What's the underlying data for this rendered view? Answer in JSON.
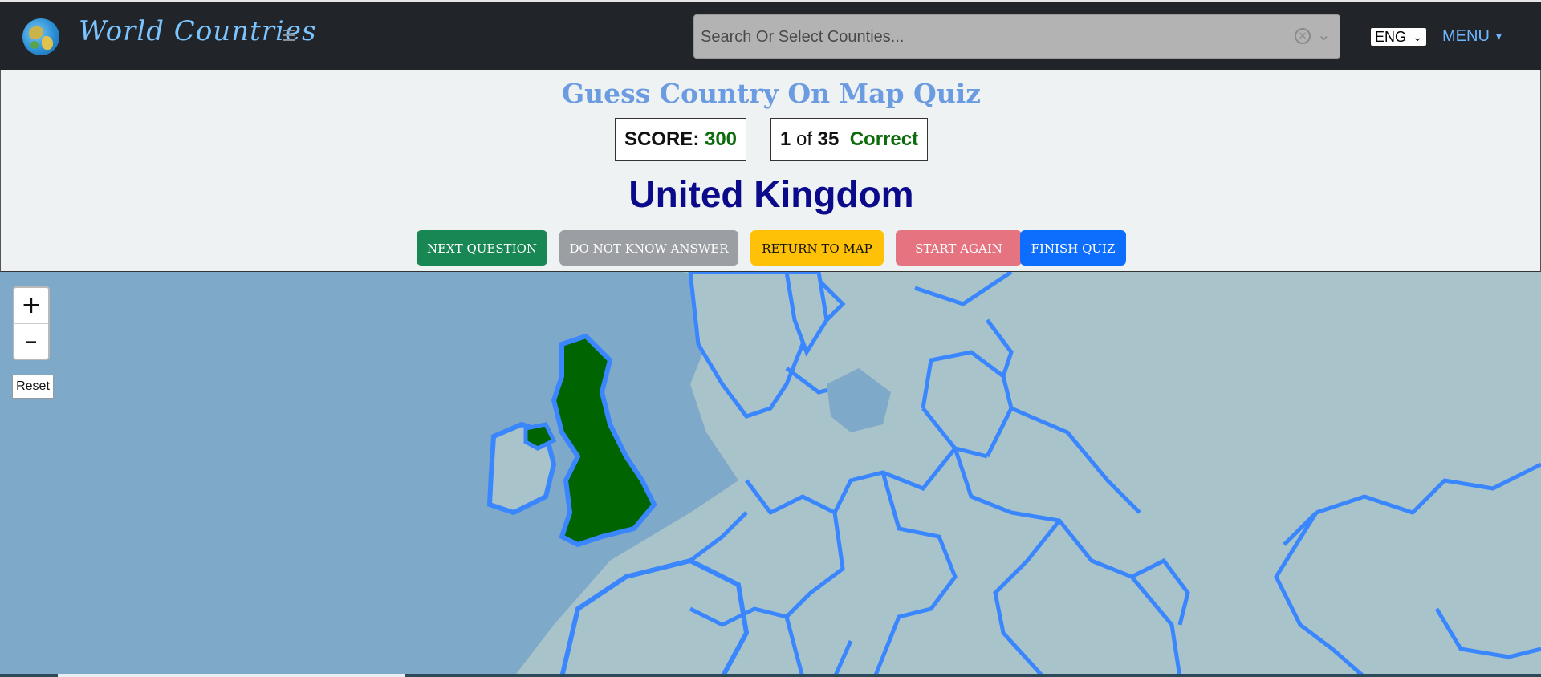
{
  "header": {
    "brand": "World Countries",
    "search_placeholder": "Search Or Select Counties...",
    "language": "ENG",
    "menu_label": "MENU"
  },
  "quiz": {
    "title": "Guess Country On Map Quiz",
    "score_label": "SCORE:",
    "score_value": "300",
    "progress_current": "1",
    "progress_of": "of",
    "progress_total": "35",
    "progress_status": "Correct",
    "country": "United Kingdom",
    "buttons": {
      "next": "NEXT QUESTION",
      "dont_know": "DO NOT KNOW ANSWER",
      "return_map": "RETURN TO MAP",
      "start_again": "START AGAIN",
      "finish": "FINISH QUIZ"
    }
  },
  "map": {
    "zoom_in": "+",
    "zoom_out": "–",
    "reset_label": "Reset",
    "highlighted_color": "#006400",
    "border_color": "#3a86ff",
    "sea_color": "#7fa9c9",
    "land_color": "#a8c3c9"
  }
}
